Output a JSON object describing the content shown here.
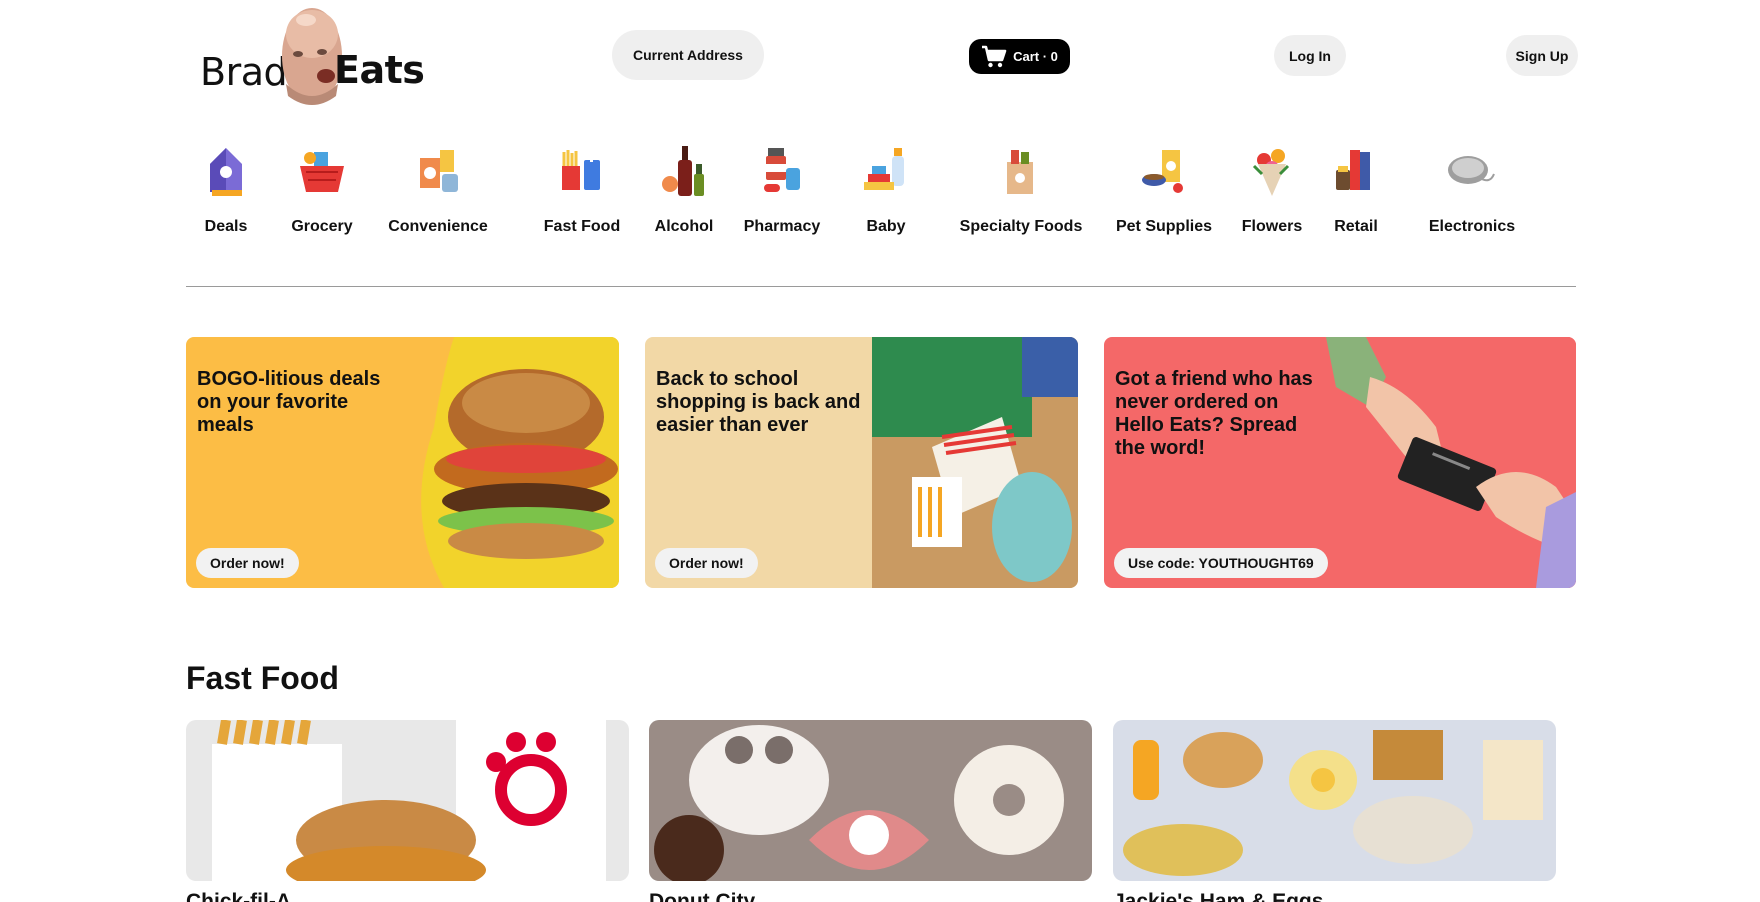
{
  "header": {
    "logo": {
      "left_text": "Brad",
      "right_text": "Eats"
    },
    "address_button": "Current Address",
    "cart": {
      "label": "Cart · 0"
    },
    "login_button": "Log In",
    "signup_button": "Sign Up"
  },
  "categories": [
    {
      "label": "Deals",
      "icon": "deals-icon"
    },
    {
      "label": "Grocery",
      "icon": "grocery-basket-icon"
    },
    {
      "label": "Convenience",
      "icon": "convenience-icon"
    },
    {
      "label": "Fast Food",
      "icon": "fast-food-icon"
    },
    {
      "label": "Alcohol",
      "icon": "alcohol-bottles-icon"
    },
    {
      "label": "Pharmacy",
      "icon": "pharmacy-icon"
    },
    {
      "label": "Baby",
      "icon": "baby-bottle-icon"
    },
    {
      "label": "Specialty Foods",
      "icon": "specialty-foods-icon"
    },
    {
      "label": "Pet Supplies",
      "icon": "pet-supplies-icon"
    },
    {
      "label": "Flowers",
      "icon": "flowers-icon"
    },
    {
      "label": "Retail",
      "icon": "retail-books-icon"
    },
    {
      "label": "Electronics",
      "icon": "computer-mouse-icon"
    }
  ],
  "promos": [
    {
      "text": "BOGO-litious deals on your favorite meals",
      "button": "Order now!",
      "color": "#fcbd45"
    },
    {
      "text": "Back to school shopping is back and easier than ever",
      "button": "Order now!",
      "color": "#f2d8a6"
    },
    {
      "text": "Got a friend who has never ordered on Hello Eats? Spread the word!",
      "button": "Use code: YOUTHOUGHT69",
      "color": "#f46868"
    }
  ],
  "section": {
    "title": "Fast Food",
    "stores": [
      {
        "name": "Chick-fil-A"
      },
      {
        "name": "Donut City"
      },
      {
        "name": "Jackie's Ham & Eggs"
      }
    ]
  }
}
